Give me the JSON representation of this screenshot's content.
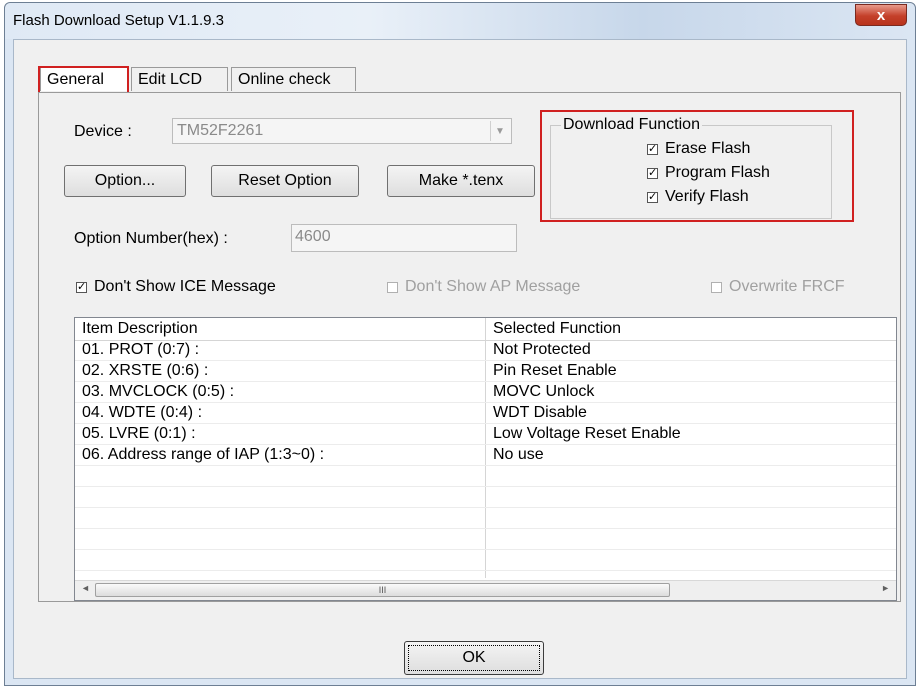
{
  "window": {
    "title": "Flash Download Setup V1.1.9.3",
    "close_label": "x"
  },
  "tabs": [
    {
      "label": "General",
      "active": true
    },
    {
      "label": "Edit LCD",
      "active": false
    },
    {
      "label": "Online check",
      "active": false
    }
  ],
  "device": {
    "label": "Device :",
    "value": "TM52F2261",
    "arrow": "▼"
  },
  "buttons": {
    "option": "Option...",
    "reset_option": "Reset Option",
    "make": "Make *.tenx",
    "ok": "OK"
  },
  "download_function": {
    "title": "Download Function",
    "items": [
      {
        "label": "Erase Flash",
        "checked": true
      },
      {
        "label": "Program Flash",
        "checked": true
      },
      {
        "label": "Verify Flash",
        "checked": true
      }
    ]
  },
  "option_number": {
    "label": "Option Number(hex) :",
    "value": "4600"
  },
  "checkboxes": [
    {
      "label": "Don't Show ICE Message",
      "checked": true,
      "enabled": true
    },
    {
      "label": "Don't Show AP Message",
      "checked": false,
      "enabled": false
    },
    {
      "label": "Overwrite FRCF",
      "checked": false,
      "enabled": false
    }
  ],
  "table": {
    "columns": [
      "Item Description",
      "Selected Function"
    ],
    "rows": [
      [
        "01. PROT (0:7) :",
        "Not Protected"
      ],
      [
        "02. XRSTE (0:6) :",
        "Pin Reset Enable"
      ],
      [
        "03. MVCLOCK (0:5) :",
        "MOVC Unlock"
      ],
      [
        "04. WDTE (0:4) :",
        "WDT Disable"
      ],
      [
        "05. LVRE (0:1) :",
        "Low Voltage Reset Enable"
      ],
      [
        "06. Address range of IAP (1:3~0)  :",
        "No use"
      ]
    ]
  },
  "scrollbar": {
    "left_arrow": "◄",
    "right_arrow": "►",
    "grip": "III"
  },
  "check_mark": "✓",
  "colors": {
    "highlight": "#d02020",
    "titlebar": "#dbe6f3",
    "close": "#c4402a"
  }
}
